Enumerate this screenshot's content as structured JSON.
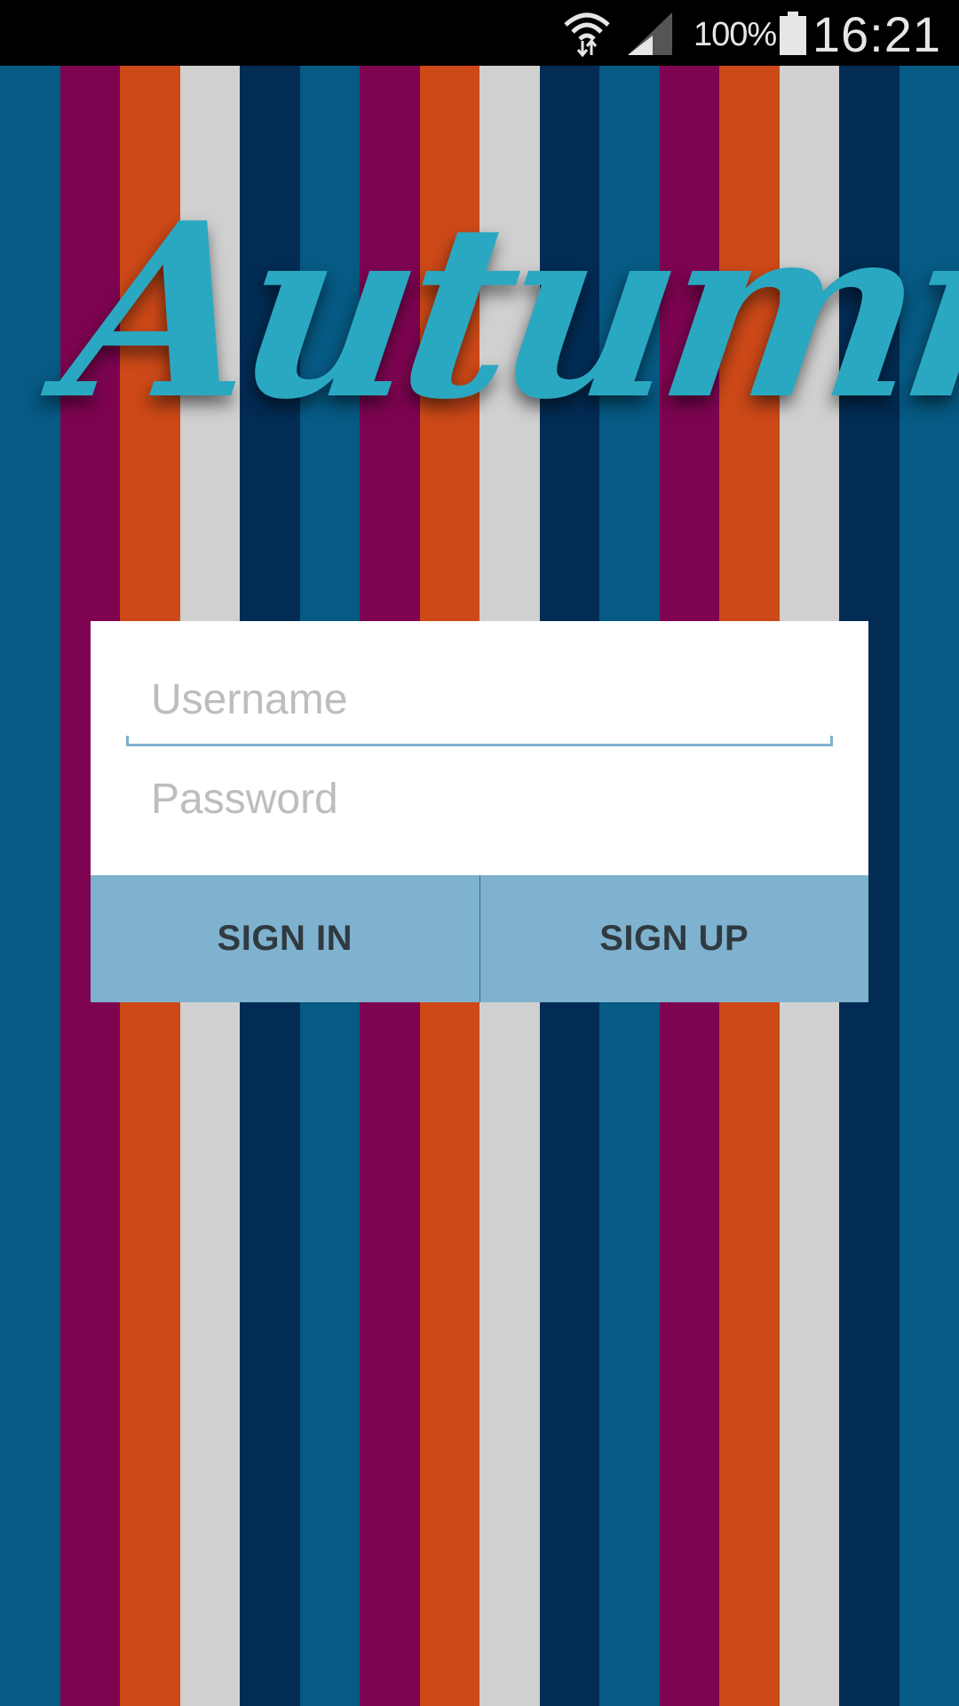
{
  "status_bar": {
    "battery_percent": "100%",
    "time": "16:21",
    "icons": [
      "wifi-icon",
      "signal-icon",
      "battery-icon"
    ]
  },
  "background": {
    "stripe_colors": [
      "#065a84",
      "#7e0451",
      "#cd4918",
      "#d0d0d0",
      "#022c54",
      "#065a84",
      "#7e0451",
      "#cd4918",
      "#d0d0d0",
      "#022c54",
      "#065a84",
      "#7e0451",
      "#cd4918",
      "#d0d0d0",
      "#022c54",
      "#065a84"
    ]
  },
  "logo": {
    "text": "Autumn",
    "color": "#2aa8c2"
  },
  "login": {
    "username_placeholder": "Username",
    "username_value": "",
    "password_placeholder": "Password",
    "password_value": "",
    "sign_in_label": "SIGN IN",
    "sign_up_label": "SIGN UP",
    "accent_color": "#7fb2cf"
  }
}
